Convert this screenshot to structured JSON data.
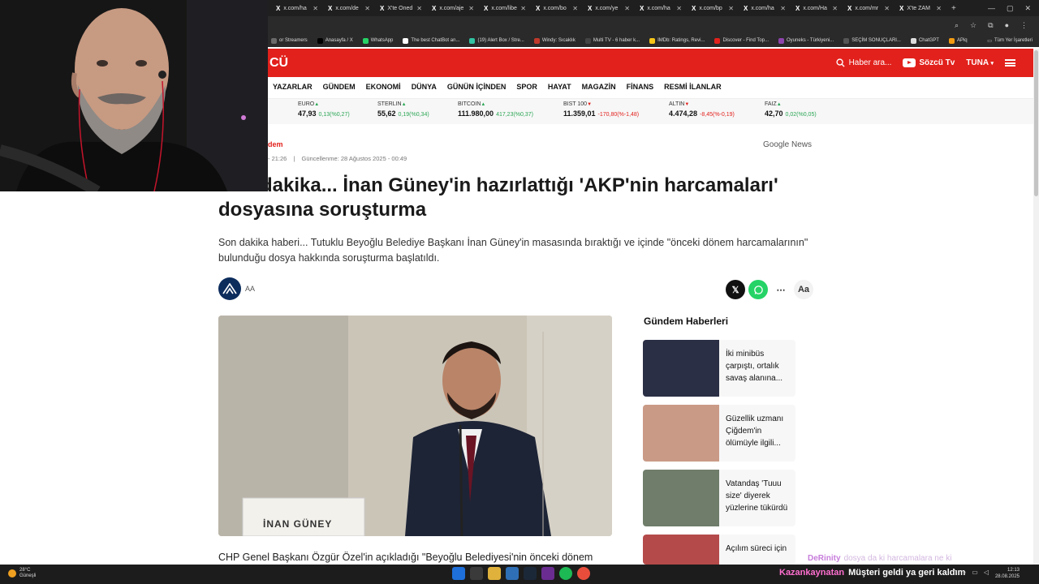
{
  "browser": {
    "tabs": [
      {
        "label": "x.com/ha"
      },
      {
        "label": "x.com/de"
      },
      {
        "label": "X'te Oned"
      },
      {
        "label": "x.com/aje"
      },
      {
        "label": "x.com/libe"
      },
      {
        "label": "x.com/bo"
      },
      {
        "label": "x.com/ye"
      },
      {
        "label": "x.com/ha"
      },
      {
        "label": "x.com/bp"
      },
      {
        "label": "x.com/ha"
      },
      {
        "label": "x.com/Ha"
      },
      {
        "label": "x.com/mr"
      },
      {
        "label": "X'te ZAM"
      }
    ],
    "new_tab": "+",
    "bookmarks": [
      {
        "label": "or Streamers",
        "color": "#6a6a6a"
      },
      {
        "label": "Anasayfa / X",
        "color": "#000000"
      },
      {
        "label": "WhatsApp",
        "color": "#25d366"
      },
      {
        "label": "The best ChatBot an...",
        "color": "#ffffff"
      },
      {
        "label": "(19) Alert Box / Stre...",
        "color": "#31c3a2"
      },
      {
        "label": "Windy: Sıcaklık",
        "color": "#c0392b"
      },
      {
        "label": "Multi TV - 6 haber k...",
        "color": "#444444"
      },
      {
        "label": "IMDb: Ratings, Revi...",
        "color": "#f5c518"
      },
      {
        "label": "Discover - Find Top...",
        "color": "#e2211c"
      },
      {
        "label": "Oyuneks - Türkiyeni...",
        "color": "#8e44ad"
      },
      {
        "label": "SEÇİM SONUÇLARI...",
        "color": "#555555"
      },
      {
        "label": "ChatGPT",
        "color": "#dddddd"
      },
      {
        "label": "APiq",
        "color": "#f39c12"
      }
    ],
    "all_bookmarks": "Tüm Yer İşaretleri"
  },
  "site": {
    "logo": "CÜ",
    "search_placeholder": "Haber ara...",
    "tv_label": "Sözcü Tv",
    "user_label": "TUNA",
    "nav": [
      "YAZARLAR",
      "GÜNDEM",
      "EKONOMİ",
      "DÜNYA",
      "GÜNÜN İÇİNDEN",
      "SPOR",
      "HAYAT",
      "MAGAZİN",
      "FİNANS",
      "RESMİ İLANLAR"
    ],
    "ticker": [
      {
        "name": "EURO",
        "value": "47,93",
        "change": "0,13(%0,27)",
        "dir": "up"
      },
      {
        "name": "STERLIN",
        "value": "55,62",
        "change": "0,19(%0,34)",
        "dir": "up"
      },
      {
        "name": "BITCOIN",
        "value": "111.980,00",
        "change": "417,23(%0,37)",
        "dir": "up"
      },
      {
        "name": "BIST 100",
        "value": "11.359,01",
        "change": "-170,80(%-1,48)",
        "dir": "down"
      },
      {
        "name": "ALTIN",
        "value": "4.474,28",
        "change": "-8,45(%-0,19)",
        "dir": "down"
      },
      {
        "name": "FAIZ",
        "value": "42,70",
        "change": "0,02(%0,05)",
        "dir": "up"
      }
    ]
  },
  "article": {
    "category": "dem",
    "published": "- 21:26",
    "separator": "|",
    "updated": "Güncellenme: 28 Ağustos 2025 - 00:49",
    "google_news": "Google News",
    "headline": "Son dakika... İnan Güney'in hazırlattığı 'AKP'nin harcamaları' dosyasına soruşturma",
    "spot": "Son dakika haberi... Tutuklu Beyoğlu Belediye Başkanı İnan Güney'in masasında bıraktığı ve içinde \"önceki dönem harcamalarının\" bulunduğu dosya hakkında soruşturma başlatıldı.",
    "source": "AA",
    "nameplate": "İNAN GÜNEY",
    "body_start": "CHP Genel Başkanı Özgür Özel'in açıkladığı \"Beyoğlu Belediyesi'nin önceki dönem",
    "share_more": "⋯",
    "font_size_label": "Aa"
  },
  "sidebar": {
    "title": "Gündem Haberleri",
    "items": [
      {
        "text": "İki minibüs çarpıştı, ortalık savaş alanına...",
        "thumb": "#2b2f45"
      },
      {
        "text": "Güzellik uzmanı Çiğdem'in ölümüyle ilgili...",
        "thumb": "#c99a86"
      },
      {
        "text": "Vatandaş 'Tuuu size' diyerek yüzlerine tükürdü",
        "thumb": "#6f7d6a"
      },
      {
        "text": "Açılım süreci için",
        "thumb": "#b44a4a"
      }
    ]
  },
  "overlay": {
    "chat1_user": "DeRinity",
    "chat1_msg": "dosya da ki harcamalara ne ki",
    "chat2_user": "Kazankaynatan",
    "chat2_msg": "Müşteri geldi ya geri kaldım"
  },
  "taskbar": {
    "temp": "28°C",
    "weather": "Güneşli",
    "time": "12:13",
    "date": "28.08.2025"
  }
}
